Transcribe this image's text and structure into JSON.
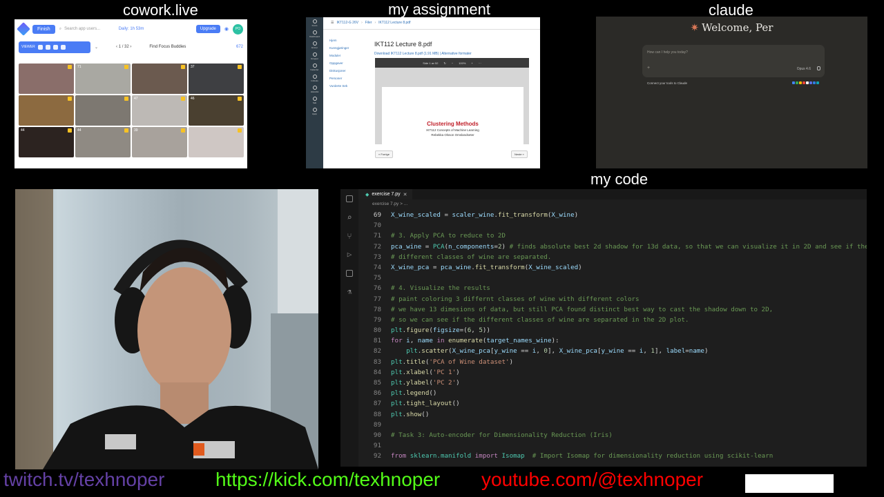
{
  "titles": {
    "cowork": "cowork.live",
    "assignment": "my assignment",
    "claude": "claude",
    "code": "my code"
  },
  "cowork": {
    "finish": "Finish",
    "search_placeholder": "Search app users...",
    "daily": "Daily: 1h 53m",
    "upgrade": "Upgrade",
    "avatar": "PO",
    "viewer": "VIEWER",
    "pages": "1 / 32",
    "find_buddies": "Find Focus Buddies",
    "count": "672",
    "tiles": [
      {
        "label": "",
        "color": "#8a6e6a"
      },
      {
        "label": "71",
        "color": "#a9a8a2"
      },
      {
        "label": "",
        "color": "#6b5a4f"
      },
      {
        "label": "37",
        "color": "#3e3f42"
      },
      {
        "label": "",
        "color": "#8c6a40"
      },
      {
        "label": "",
        "color": "#7d7871"
      },
      {
        "label": "47",
        "color": "#bdb9b5"
      },
      {
        "label": "46",
        "color": "#4a4030"
      },
      {
        "label": "44",
        "color": "#2c2320"
      },
      {
        "label": "44",
        "color": "#8f8a83"
      },
      {
        "label": "39",
        "color": "#a8a29c"
      },
      {
        "label": "",
        "color": "#cfc7c4"
      }
    ]
  },
  "assignment": {
    "breadcrumb": [
      "IKT112-G 26V",
      "Filer",
      "IKT112 Lecture 8.pdf"
    ],
    "nav": [
      "Konto",
      "Dashboard",
      "Emner",
      "Grupper",
      "Kalender",
      "Innboks",
      "Historikk",
      "Søk",
      "Hjelp"
    ],
    "side_links": [
      "Hjem",
      "Kunngjøringer",
      "Moduler",
      "Oppgaver",
      "Diskusjoner",
      "Personer",
      "Vurderte Sek"
    ],
    "file_title": "IKT112 Lecture 8.pdf",
    "download": "Download IKT112 Lecture 8.pdf (1.91 MB) | Alternative formater",
    "viewer_page": "Side 1 av 52",
    "zoom": "100%",
    "slide_title": "Clustering Methods",
    "slide_sub1": "IKT112 Concepts of Machine Learning",
    "slide_sub2": "Rebekka Olsson Omslandseter",
    "prev": "« Forrige",
    "next": "Neste »"
  },
  "claude": {
    "welcome": "Welcome, Per",
    "placeholder": "How can I help you today?",
    "model": "Opus 4.6",
    "connect": "Connect your tools to Claude"
  },
  "code": {
    "tab": "exercise 7.py",
    "crumb": "exercise 7.py > ...",
    "lines": [
      {
        "n": "69",
        "html": "<span class='tk-v'>X_wine_scaled</span> = <span class='tk-v'>scaler_wine</span>.<span class='tk-f'>fit_transform</span>(<span class='tk-v'>X_wine</span>)"
      },
      {
        "n": "70",
        "html": ""
      },
      {
        "n": "71",
        "html": "<span class='tk-c'># 3. Apply PCA to reduce to 2D</span>"
      },
      {
        "n": "72",
        "html": "<span class='tk-v'>pca_wine</span> = <span class='tk-cl'>PCA</span>(<span class='tk-v'>n_components</span>=<span class='tk-n'>2</span>) <span class='tk-c'># finds absolute best 2d shadow for 13d data, so that we can visualize it in 2D and see if the</span>"
      },
      {
        "n": "73",
        "html": "<span class='tk-c'># different classes of wine are separated.</span>"
      },
      {
        "n": "74",
        "html": "<span class='tk-v'>X_wine_pca</span> = <span class='tk-v'>pca_wine</span>.<span class='tk-f'>fit_transform</span>(<span class='tk-v'>X_wine_scaled</span>)"
      },
      {
        "n": "75",
        "html": ""
      },
      {
        "n": "76",
        "html": "<span class='tk-c'># 4. Visualize the results</span>"
      },
      {
        "n": "77",
        "html": "<span class='tk-c'># paint coloring 3 differnt classes of wine with different colors</span>"
      },
      {
        "n": "78",
        "html": "<span class='tk-c'># we have 13 dimesions of data, but still PCA found distinct best way to cast the shadow down to 2D,</span>"
      },
      {
        "n": "79",
        "html": "<span class='tk-c'># so we can see if the different classes of wine are separated in the 2D plot.</span>"
      },
      {
        "n": "80",
        "html": "<span class='tk-cl'>plt</span>.<span class='tk-f'>figure</span>(<span class='tk-v'>figsize</span>=(<span class='tk-n'>6</span>, <span class='tk-n'>5</span>))"
      },
      {
        "n": "81",
        "html": "<span class='tk-k'>for</span> <span class='tk-v'>i</span>, <span class='tk-v'>name</span> <span class='tk-k'>in</span> <span class='tk-f'>enumerate</span>(<span class='tk-v'>target_names_wine</span>):"
      },
      {
        "n": "82",
        "html": "    <span class='tk-cl'>plt</span>.<span class='tk-f'>scatter</span>(<span class='tk-v'>X_wine_pca</span>[<span class='tk-v'>y_wine</span> == <span class='tk-v'>i</span>, <span class='tk-n'>0</span>], <span class='tk-v'>X_wine_pca</span>[<span class='tk-v'>y_wine</span> == <span class='tk-v'>i</span>, <span class='tk-n'>1</span>], <span class='tk-v'>label</span>=<span class='tk-v'>name</span>)"
      },
      {
        "n": "83",
        "html": "<span class='tk-cl'>plt</span>.<span class='tk-f'>title</span>(<span class='tk-s'>'PCA of Wine dataset'</span>)"
      },
      {
        "n": "84",
        "html": "<span class='tk-cl'>plt</span>.<span class='tk-f'>xlabel</span>(<span class='tk-s'>'PC 1'</span>)"
      },
      {
        "n": "85",
        "html": "<span class='tk-cl'>plt</span>.<span class='tk-f'>ylabel</span>(<span class='tk-s'>'PC 2'</span>)"
      },
      {
        "n": "86",
        "html": "<span class='tk-cl'>plt</span>.<span class='tk-f'>legend</span>()"
      },
      {
        "n": "87",
        "html": "<span class='tk-cl'>plt</span>.<span class='tk-f'>tight_layout</span>()"
      },
      {
        "n": "88",
        "html": "<span class='tk-cl'>plt</span>.<span class='tk-f'>show</span>()"
      },
      {
        "n": "89",
        "html": ""
      },
      {
        "n": "90",
        "html": "<span class='tk-c'># Task 3: Auto-encoder for Dimensionality Reduction (Iris)</span>"
      },
      {
        "n": "91",
        "html": ""
      },
      {
        "n": "92",
        "html": "<span class='tk-k'>from</span> <span class='tk-cl'>sklearn.manifold</span> <span class='tk-k'>import</span> <span class='tk-cl'>Isomap</span>  <span class='tk-c'># Import Isomap for dimensionality reduction using scikit-learn</span>"
      }
    ]
  },
  "links": {
    "twitch": "twitch.tv/texhnoper",
    "kick": "https://kick.com/texhnoper",
    "youtube": "youtube.com/@texhnoper",
    "twitch_color": "#6441a5",
    "kick_color": "#53fc18",
    "youtube_color": "#ff0000"
  }
}
